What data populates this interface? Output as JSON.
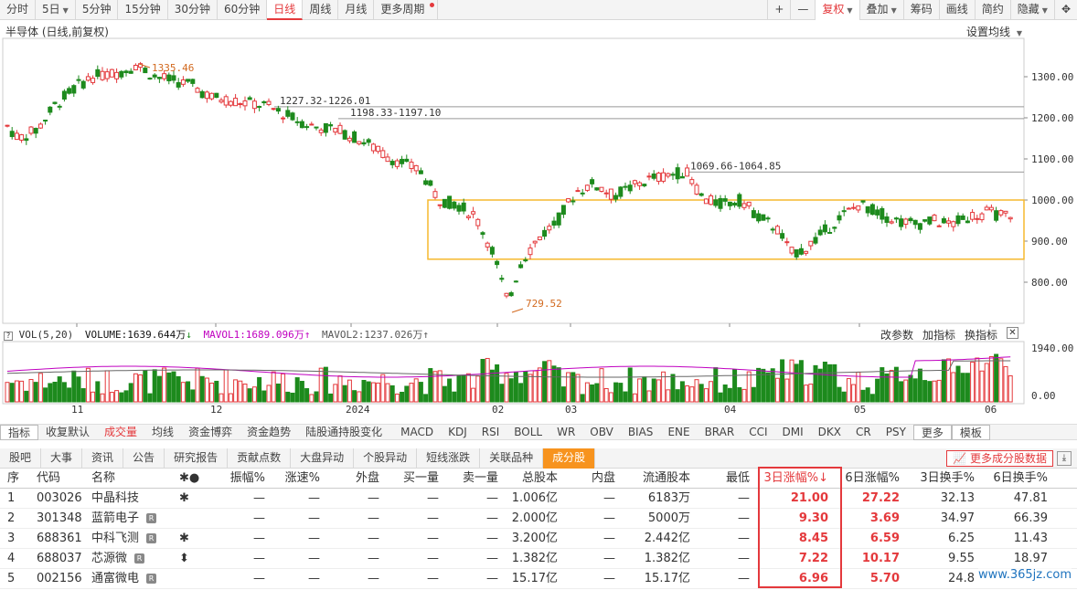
{
  "toolbar": {
    "left": [
      "分时",
      "5日",
      "5分钟",
      "15分钟",
      "30分钟",
      "60分钟",
      "日线",
      "周线",
      "月线",
      "更多周期"
    ],
    "right": [
      "+",
      "—",
      "复权",
      "叠加",
      "筹码",
      "画线",
      "简约",
      "隐藏"
    ]
  },
  "chart": {
    "title": "半导体 (日线,前复权)",
    "settings_label": "设置均线",
    "price_ticks": [
      "1300.00",
      "1200.00",
      "1100.00",
      "1000.00",
      "900.00",
      "800.00"
    ],
    "annotations": [
      "1335.46",
      "1227.32-1226.01",
      "1198.33-1197.10",
      "1069.66-1064.85",
      "729.52"
    ],
    "date_labels": [
      "11",
      "12",
      "2024",
      "02",
      "03",
      "04",
      "05",
      "06"
    ],
    "vol_label": "VOL(5,20)",
    "volume_text": "VOLUME:1639.644万",
    "mavol1_text": "MAVOL1:1689.096万",
    "mavol2_text": "MAVOL2:1237.026万",
    "vol_ticks": [
      "1940.00",
      "0.00"
    ],
    "vol_links": [
      "改参数",
      "加指标",
      "换指标"
    ]
  },
  "colors": {
    "up": "#e4393c",
    "down": "#1d8a1d",
    "accent": "#f7931e"
  },
  "indicator_tabs": [
    "指标",
    "收复默认",
    "成交量",
    "均线",
    "资金博弈",
    "资金趋势",
    "陆股通持股变化",
    "MACD",
    "KDJ",
    "RSI",
    "BOLL",
    "WR",
    "OBV",
    "BIAS",
    "ENE",
    "BRAR",
    "CCI",
    "DMI",
    "DKX",
    "CR",
    "PSY",
    "更多",
    "模板"
  ],
  "section_tabs": [
    "股吧",
    "大事",
    "资讯",
    "公告",
    "研究报告",
    "贡献点数",
    "大盘异动",
    "个股异动",
    "短线涨跌",
    "关联品种",
    "成分股"
  ],
  "more_button": "更多成分股数据",
  "table": {
    "headers": [
      "序",
      "代码",
      "名称",
      "✱●",
      "振幅%",
      "涨速%",
      "外盘",
      "买一量",
      "卖一量",
      "总股本",
      "内盘",
      "流通股本",
      "最低",
      "3日涨幅%↓",
      "6日涨幅%",
      "3日换手%",
      "6日换手%"
    ],
    "rows": [
      {
        "no": "1",
        "code": "003026",
        "name": "中晶科技",
        "r": "",
        "mark": "✱",
        "amp": "—",
        "spd": "—",
        "out": "—",
        "b1": "—",
        "s1": "—",
        "total": "1.006亿",
        "inn": "—",
        "float": "6183万",
        "low": "—",
        "d3": "21.00",
        "d6": "27.22",
        "t3": "32.13",
        "t6": "47.81"
      },
      {
        "no": "2",
        "code": "301348",
        "name": "蓝箭电子",
        "r": "R",
        "mark": "",
        "amp": "—",
        "spd": "—",
        "out": "—",
        "b1": "—",
        "s1": "—",
        "total": "2.000亿",
        "inn": "—",
        "float": "5000万",
        "low": "—",
        "d3": "9.30",
        "d6": "3.69",
        "t3": "34.97",
        "t6": "66.39"
      },
      {
        "no": "3",
        "code": "688361",
        "name": "中科飞测",
        "r": "R",
        "mark": "✱",
        "amp": "—",
        "spd": "—",
        "out": "—",
        "b1": "—",
        "s1": "—",
        "total": "3.200亿",
        "inn": "—",
        "float": "2.442亿",
        "low": "—",
        "d3": "8.45",
        "d6": "6.59",
        "t3": "6.25",
        "t6": "11.43"
      },
      {
        "no": "4",
        "code": "688037",
        "name": "芯源微",
        "r": "R",
        "mark": "⬍",
        "amp": "—",
        "spd": "—",
        "out": "—",
        "b1": "—",
        "s1": "—",
        "total": "1.382亿",
        "inn": "—",
        "float": "1.382亿",
        "low": "—",
        "d3": "7.22",
        "d6": "10.17",
        "t3": "9.55",
        "t6": "18.97"
      },
      {
        "no": "5",
        "code": "002156",
        "name": "通富微电",
        "r": "R",
        "mark": "",
        "amp": "—",
        "spd": "—",
        "out": "—",
        "b1": "—",
        "s1": "—",
        "total": "15.17亿",
        "inn": "—",
        "float": "15.17亿",
        "low": "—",
        "d3": "6.96",
        "d6": "5.70",
        "t3": "24.8",
        "t6": ""
      }
    ]
  },
  "watermark": "www.365jz.com"
}
